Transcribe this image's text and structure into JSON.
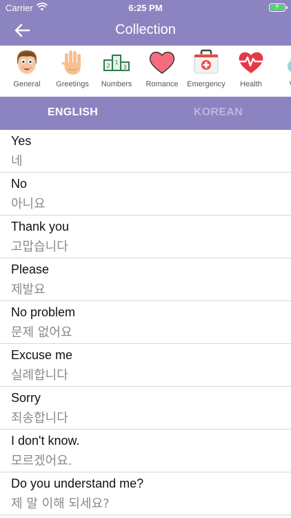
{
  "status_bar": {
    "carrier": "Carrier",
    "time": "6:25 PM"
  },
  "nav": {
    "title": "Collection"
  },
  "categories": [
    {
      "label": "General",
      "icon": "smiling-face-icon"
    },
    {
      "label": "Greetings",
      "icon": "waving-hand-icon"
    },
    {
      "label": "Numbers",
      "icon": "podium-numbers-icon"
    },
    {
      "label": "Romance",
      "icon": "heart-icon"
    },
    {
      "label": "Emergency",
      "icon": "first-aid-kit-icon"
    },
    {
      "label": "Health",
      "icon": "heartbeat-icon"
    },
    {
      "label": "We",
      "icon": "weather-icon"
    }
  ],
  "tabs": {
    "english": "ENGLISH",
    "korean": "KOREAN"
  },
  "phrases": [
    {
      "en": "Yes",
      "ko": "네"
    },
    {
      "en": "No",
      "ko": "아니요"
    },
    {
      "en": "Thank you",
      "ko": "고맙습니다"
    },
    {
      "en": "Please",
      "ko": "제발요"
    },
    {
      "en": "No problem",
      "ko": "문제 없어요"
    },
    {
      "en": "Excuse me",
      "ko": "실례합니다"
    },
    {
      "en": "Sorry",
      "ko": "죄송합니다"
    },
    {
      "en": "I don't know.",
      "ko": "모르겠어요."
    },
    {
      "en": "Do you understand me?",
      "ko": "제 말 이해 되세요?"
    }
  ],
  "colors": {
    "accent": "#8c84c0",
    "tab_inactive": "#bdb6e0",
    "subtext": "#8a8a8a"
  }
}
